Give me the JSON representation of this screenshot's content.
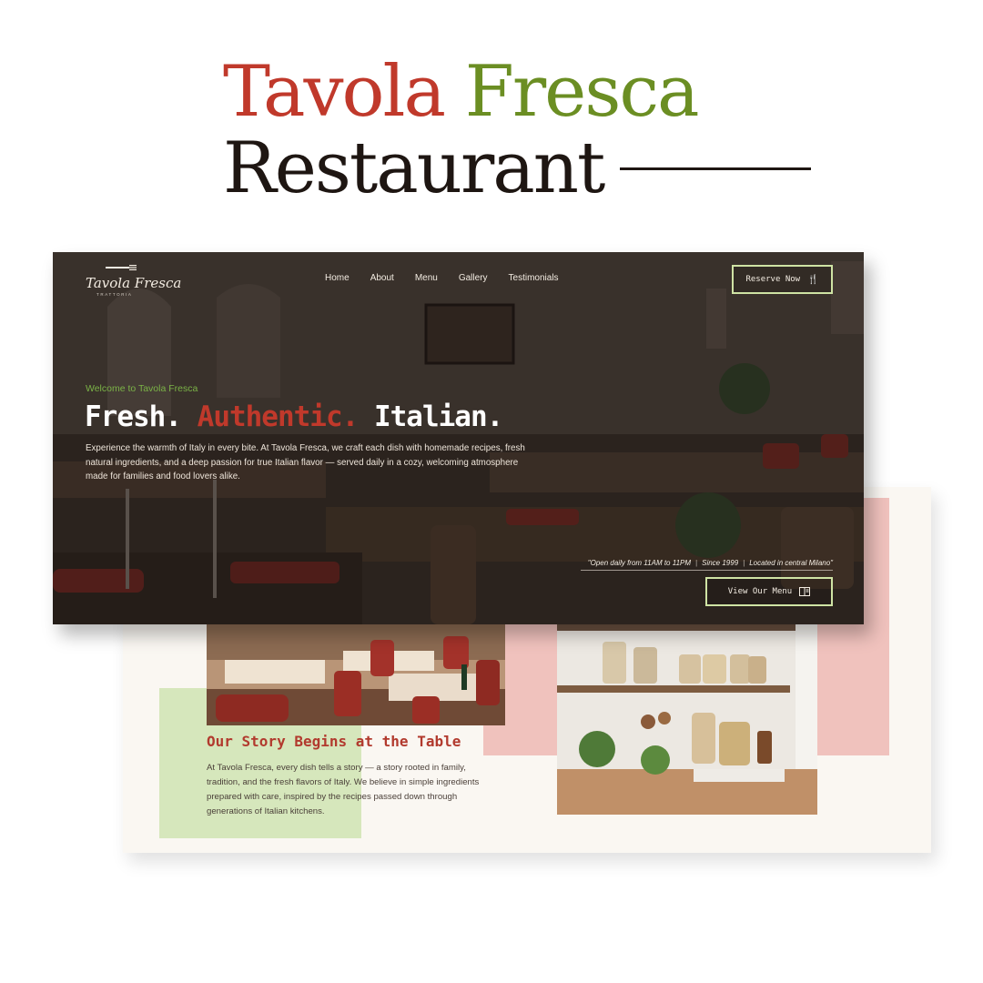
{
  "headline": {
    "word1": "Tavola",
    "word2": "Fresca",
    "word3": "Restaurant"
  },
  "hero": {
    "logo": {
      "script": "Tavola Fresca",
      "sub": "TRATTORIA"
    },
    "nav": [
      "Home",
      "About",
      "Menu",
      "Gallery",
      "Testimonials"
    ],
    "reserve_label": "Reserve Now",
    "welcome": "Welcome to Tavola Fresca",
    "heading": {
      "part1": "Fresh.",
      "part2": "Authentic.",
      "part3": "Italian."
    },
    "description": "Experience the warmth of Italy in every bite. At Tavola Fresca, we craft each dish with homemade recipes, fresh natural ingredients, and a deep passion for true Italian flavor — served daily in a cozy, welcoming atmosphere made for families and food lovers alike.",
    "info": {
      "hours": "\"Open daily from 11AM to 11PM",
      "since": "Since 1999",
      "location": "Located in central Milano\""
    },
    "menu_label": "View Our Menu",
    "icons": {
      "reserve": "utensils-icon",
      "menu": "menu-book-icon",
      "logo": "fork-icon"
    }
  },
  "about": {
    "title": "Our Story Begins at the Table",
    "body": "At Tavola Fresca, every dish tells a story — a story rooted in family, tradition, and the fresh flavors of Italy. We believe in simple ingredients prepared with care, inspired by the recipes passed down through generations of Italian kitchens."
  },
  "colors": {
    "brand_red": "#c0392b",
    "brand_green": "#6b8e23",
    "accent_green": "#7bb347",
    "button_border": "#cfe3a4",
    "pink_block": "#f0c2bd",
    "green_block": "#d6e7bc"
  }
}
